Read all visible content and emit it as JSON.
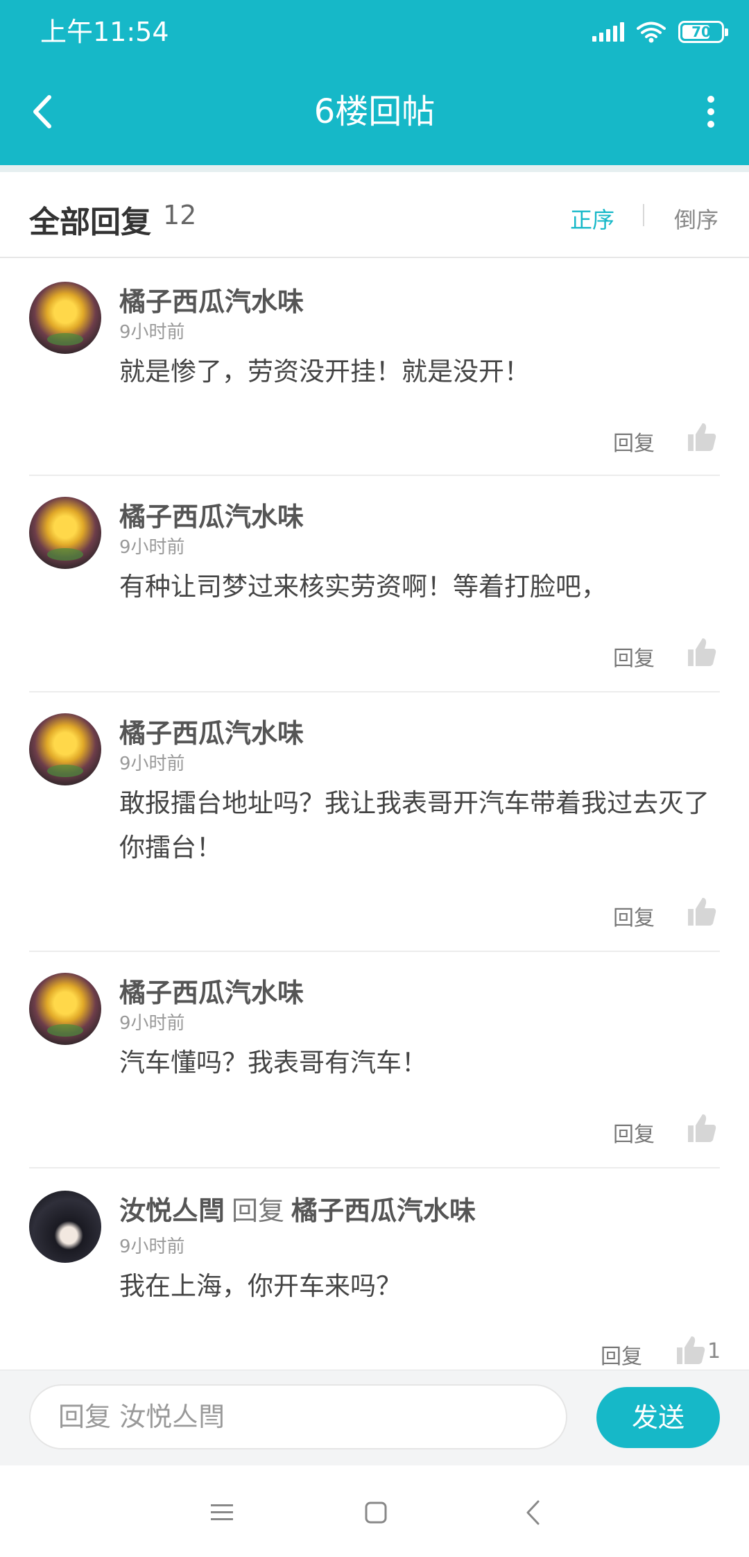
{
  "status_bar": {
    "time": "上午11:54",
    "battery": "70",
    "icons": [
      "signal-icon",
      "wifi-icon",
      "battery-icon"
    ]
  },
  "header": {
    "title": "6楼回帖",
    "back_icon": "chevron-left-icon",
    "more_icon": "more-vertical-icon"
  },
  "replies_header": {
    "title": "全部回复",
    "count": "12",
    "sort_asc": "正序",
    "sort_desc": "倒序"
  },
  "replies": [
    {
      "user": "橘子西瓜汽水味",
      "time": "9小时前",
      "content": "就是惨了，劳资没开挂！就是没开！",
      "reply_label": "回复",
      "likes": ""
    },
    {
      "user": "橘子西瓜汽水味",
      "time": "9小时前",
      "content": "有种让司梦过来核实劳资啊！等着打脸吧，",
      "reply_label": "回复",
      "likes": ""
    },
    {
      "user": "橘子西瓜汽水味",
      "time": "9小时前",
      "content": "敢报擂台地址吗？我让我表哥开汽车带着我过去灭了你擂台！",
      "reply_label": "回复",
      "likes": ""
    },
    {
      "user": "橘子西瓜汽水味",
      "time": "9小时前",
      "content": "汽车懂吗？我表哥有汽车！",
      "reply_label": "回复",
      "likes": ""
    },
    {
      "user": "汝悦亼閆",
      "reply_word": "回复",
      "reply_to": "橘子西瓜汽水味",
      "time": "9小时前",
      "content": "我在上海，你开车来吗？",
      "reply_label": "回复",
      "likes": "1"
    }
  ],
  "input_bar": {
    "placeholder": "回复 汝悦亼閆",
    "send_label": "发送"
  },
  "nav_bar": {
    "icons": [
      "menu-icon",
      "home-square-icon",
      "back-triangle-icon"
    ]
  },
  "colors": {
    "accent": "#16b8c8",
    "text": "#333333",
    "muted": "#999999"
  }
}
